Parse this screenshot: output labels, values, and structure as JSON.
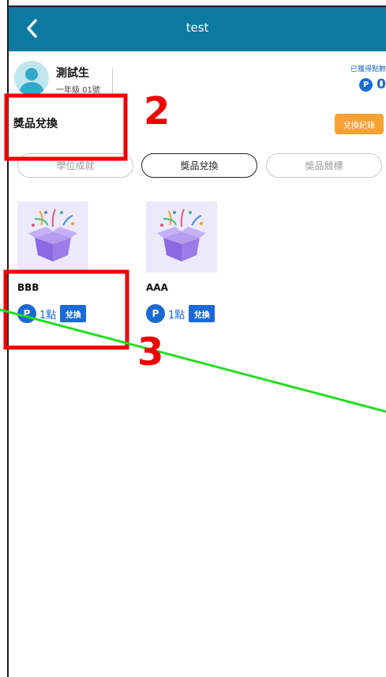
{
  "header": {
    "title": "test",
    "back_icon": "chevron-left-icon",
    "color": "#0a7aa0"
  },
  "user": {
    "name": "測試生",
    "class": "一年級 01號",
    "points_label": "已獲得點數",
    "points_icon_letter": "P",
    "points_value": "0"
  },
  "section": {
    "title": "獎品兌換",
    "record_button": "兌換紀錄"
  },
  "tabs": [
    {
      "label": "學位成就",
      "active": false
    },
    {
      "label": "獎品兌換",
      "active": true
    },
    {
      "label": "獎品競標",
      "active": false
    }
  ],
  "prizes": [
    {
      "name": "BBB",
      "icon_letter": "P",
      "price": "1點",
      "redeem_label": "兌換",
      "image_icon": "gift-box-icon"
    },
    {
      "name": "AAA",
      "icon_letter": "P",
      "price": "1點",
      "redeem_label": "兌換",
      "image_icon": "gift-box-icon"
    }
  ],
  "annotations": {
    "label_2": "2",
    "label_3": "3",
    "box_color": "#ee0000",
    "line_color": "#22dd22"
  }
}
